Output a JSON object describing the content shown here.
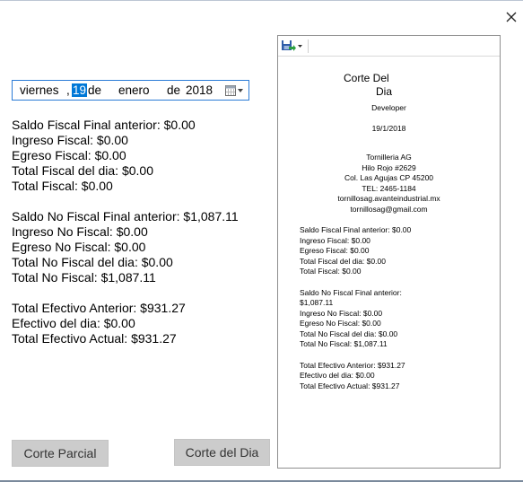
{
  "date": {
    "weekday": "viernes",
    "comma": ",",
    "day": "19",
    "de1": "de",
    "month": "enero",
    "de2": "de",
    "year": "2018"
  },
  "summary": {
    "group1": [
      "Saldo Fiscal Final anterior: $0.00",
      "Ingreso Fiscal: $0.00",
      "Egreso Fiscal: $0.00",
      "Total Fiscal del dia: $0.00",
      "Total Fiscal: $0.00"
    ],
    "group2": [
      "Saldo No Fiscal Final anterior: $1,087.11",
      "Ingreso No Fiscal: $0.00",
      "Egreso No Fiscal: $0.00",
      "Total No Fiscal del dia: $0.00",
      "Total No Fiscal: $1,087.11"
    ],
    "group3": [
      "Total Efectivo Anterior: $931.27",
      "Efectivo del dia: $0.00",
      "Total Efectivo Actual: $931.27"
    ]
  },
  "buttons": {
    "parcial": "Corte Parcial",
    "dia": "Corte del Dia"
  },
  "ticket": {
    "title_line1": "Corte Del",
    "title_line2": "Dia",
    "user": "Developer",
    "date": "19/1/2018",
    "company": [
      "Tornilleria AG",
      "Hilo Rojo #2629",
      "Col. Las Agujas  CP 45200",
      "TEL: 2465-1184",
      "tornillosag.avanteindustrial.mx",
      "tornillosag@gmail.com"
    ],
    "group1": [
      "Saldo Fiscal Final anterior: $0.00",
      "Ingreso Fiscal: $0.00",
      "Egreso Fiscal: $0.00",
      "Total Fiscal del dia: $0.00",
      "Total Fiscal: $0.00"
    ],
    "group2": [
      "Saldo No Fiscal Final anterior:",
      "$1,087.11",
      "Ingreso No Fiscal: $0.00",
      "Egreso No Fiscal: $0.00",
      "Total No Fiscal del dia: $0.00",
      "Total No Fiscal: $1,087.11"
    ],
    "group3": [
      "Total Efectivo Anterior: $931.27",
      "Efectivo del dia: $0.00",
      "Total Efectivo Actual: $931.27"
    ]
  },
  "icons": {
    "close": "close-icon",
    "calendar": "calendar-icon",
    "save": "save-icon"
  }
}
